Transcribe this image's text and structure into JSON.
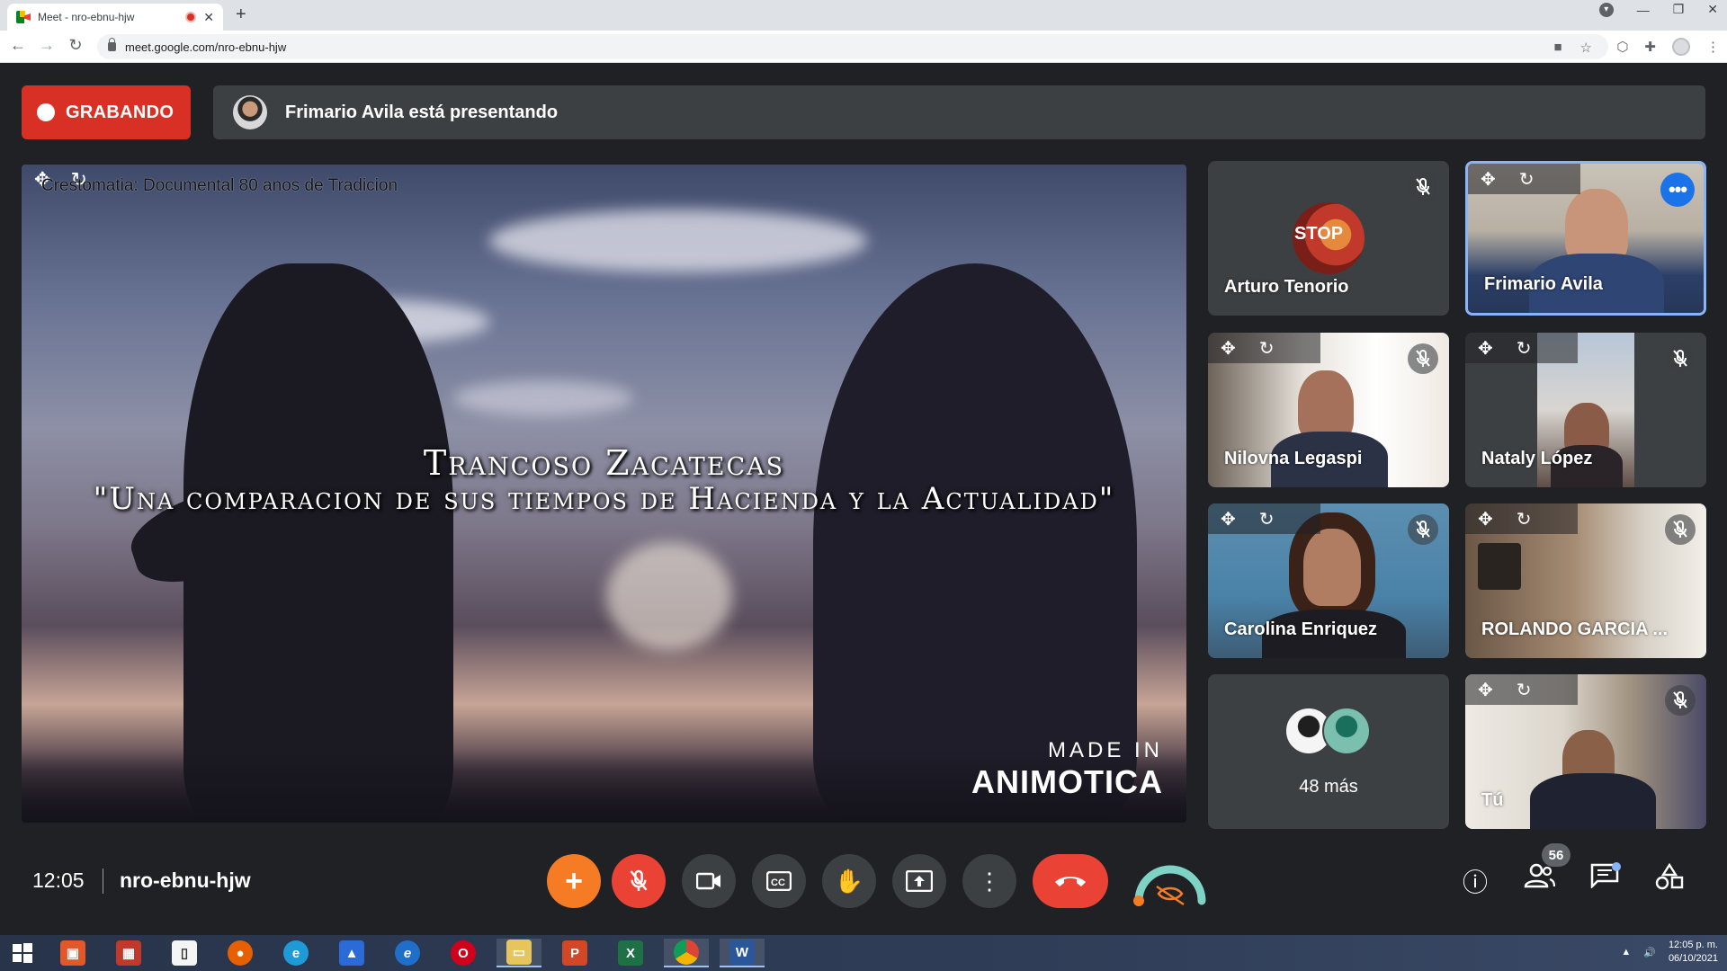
{
  "browser": {
    "tab_title": "Meet - nro-ebnu-hjw",
    "url": "meet.google.com/nro-ebnu-hjw",
    "new_tab": "+",
    "close": "✕"
  },
  "meet": {
    "recording_label": "GRABANDO",
    "presenting_text": "Frimario Avila está presentando",
    "stage": {
      "caption": "Crestomatia: Documental 80 anos de Tradicion",
      "title_line1": "Trancoso Zacatecas",
      "title_line2": "\"Una comparacion de sus tiempos de Hacienda y la Actualidad\"",
      "made_in": "MADE IN",
      "brand": "ANIMOTICA"
    },
    "tiles": [
      {
        "name": "Arturo Tenorio",
        "avatar_text": "STOP"
      },
      {
        "name": "Frimario Avila"
      },
      {
        "name": "Nilovna Legaspi"
      },
      {
        "name": "Nataly López"
      },
      {
        "name": "Carolina Enriquez"
      },
      {
        "name": "ROLANDO GARCIA ..."
      },
      {
        "more_count": "48 más"
      },
      {
        "name": "Tú"
      }
    ],
    "bottom": {
      "time": "12:05",
      "code": "nro-ebnu-hjw",
      "participants_badge": "56"
    }
  },
  "taskbar": {
    "time": "12:05 p. m.",
    "date": "06/10/2021"
  },
  "colors": {
    "recording": "#d93025",
    "leave": "#ea4335",
    "active_border": "#8ab4f8",
    "surface": "#3c4043",
    "background": "#202124"
  }
}
